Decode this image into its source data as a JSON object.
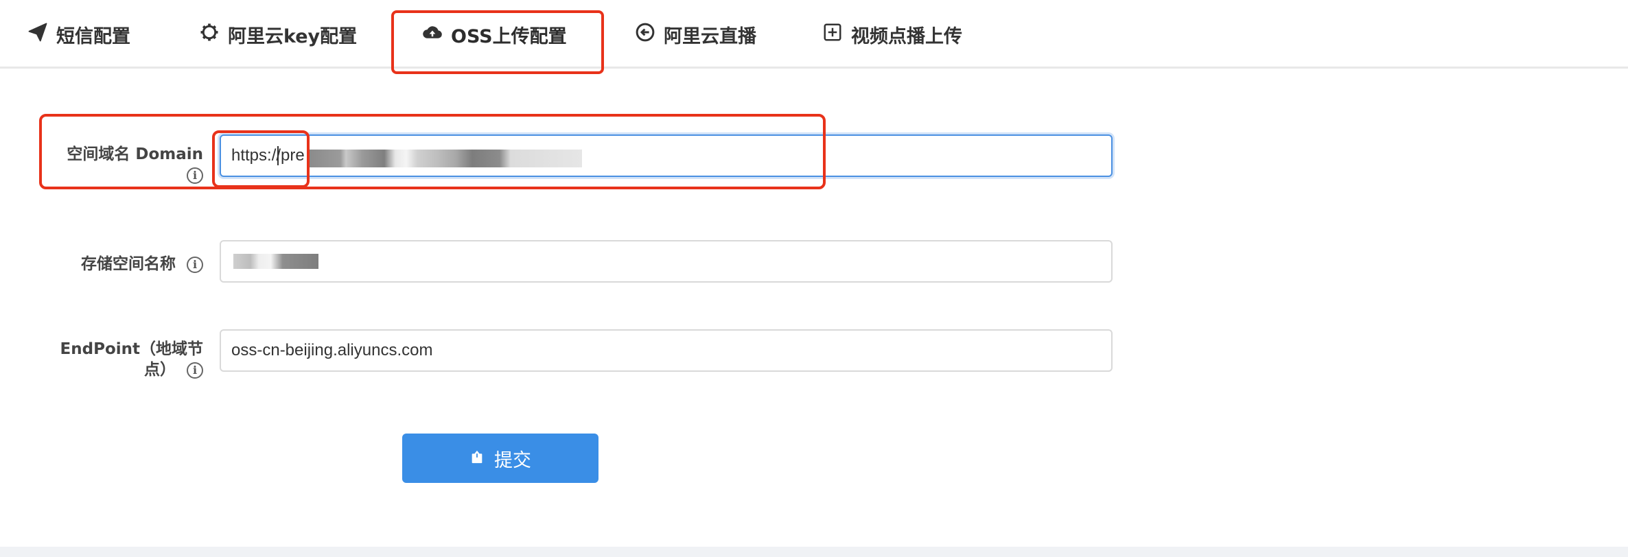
{
  "tabs": [
    {
      "label": "短信配置",
      "icon": "paper-plane-icon"
    },
    {
      "label": "阿里云key配置",
      "icon": "gear-icon"
    },
    {
      "label": "OSS上传配置",
      "icon": "cloud-upload-icon",
      "active": true
    },
    {
      "label": "阿里云直播",
      "icon": "circle-arrow-left-icon"
    },
    {
      "label": "视频点播上传",
      "icon": "plus-square-icon"
    }
  ],
  "form": {
    "domain": {
      "label_line1": "空间域名 Domain",
      "info": "i",
      "value": "https://pre"
    },
    "bucket": {
      "label": "存储空间名称",
      "info": "i",
      "value": ""
    },
    "endpoint": {
      "label_line1": "EndPoint（地域节",
      "label_line2": "点）",
      "info": "i",
      "value": "oss-cn-beijing.aliyuncs.com"
    },
    "submit_label": "提交"
  },
  "colors": {
    "accent": "#3a8ee6",
    "annotation": "#e8321a",
    "focus": "#4a90e2"
  }
}
